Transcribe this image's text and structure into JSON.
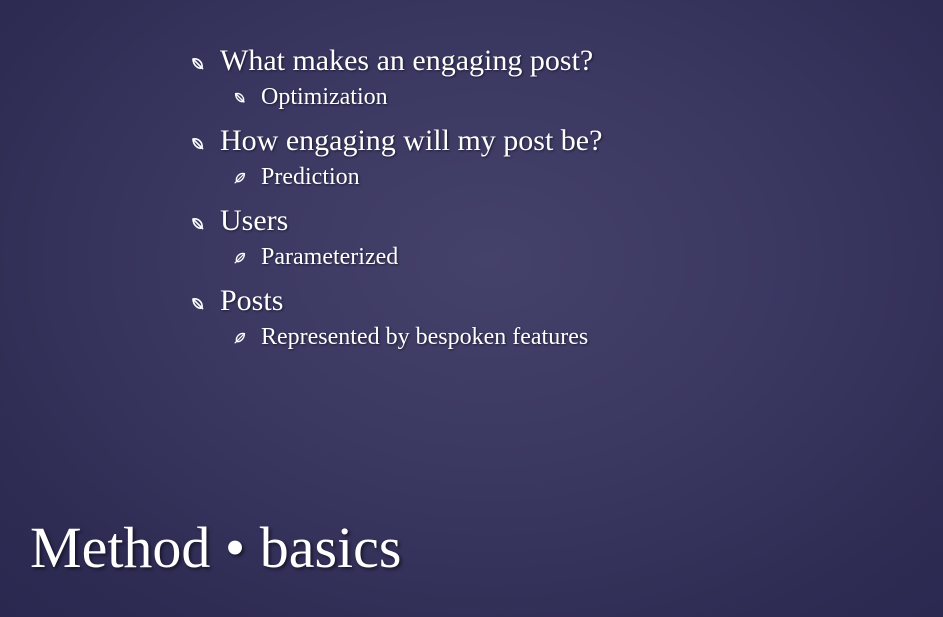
{
  "slide": {
    "title": "Method • basics",
    "bullets": [
      {
        "text": "What makes an engaging post?",
        "icon": "leaf-outline-icon",
        "sub": [
          {
            "text": "Optimization",
            "icon": "leaf-outline-icon"
          }
        ]
      },
      {
        "text": "How engaging will my post be?",
        "icon": "leaf-outline-icon",
        "sub": [
          {
            "text": "Prediction",
            "icon": "leaf-filled-icon"
          }
        ]
      },
      {
        "text": "Users",
        "icon": "leaf-outline-icon",
        "sub": [
          {
            "text": "Parameterized",
            "icon": "leaf-filled-icon"
          }
        ]
      },
      {
        "text": "Posts",
        "icon": "leaf-outline-icon",
        "sub": [
          {
            "text": "Represented by bespoken features",
            "icon": "leaf-filled-icon"
          }
        ]
      }
    ]
  },
  "colors": {
    "background": "#3b3862",
    "text": "#ffffff"
  }
}
